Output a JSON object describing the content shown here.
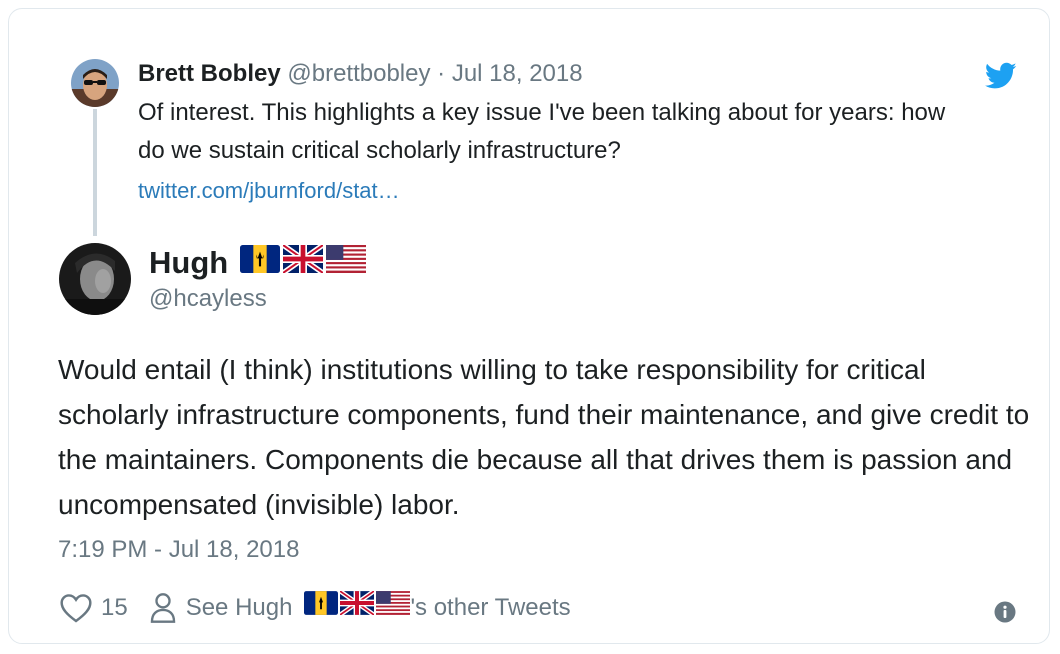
{
  "quoted": {
    "name": "Brett Bobley",
    "handle": "@brettbobley",
    "separator": "·",
    "date": "Jul 18, 2018",
    "text": "Of interest. This highlights a key issue I've been talking about for years: how do we sustain critical scholarly infrastructure?",
    "link": "twitter.com/jburnford/stat…"
  },
  "tweet": {
    "name": "Hugh",
    "handle": "@hcayless",
    "flags": [
      "barbados-flag-icon",
      "uk-flag-icon",
      "us-flag-icon"
    ],
    "text": "Would entail (I think) institutions willing to take responsibility for critical scholarly infrastructure components, fund their maintenance, and give credit to the maintainers. Components die because all that drives them is passion and uncompensated (invisible) labor.",
    "timestamp": "7:19 PM - Jul 18, 2018"
  },
  "actions": {
    "like_count": "15",
    "see_prefix": "See Hugh",
    "see_suffix": "'s other Tweets"
  },
  "icons": {
    "brand": "twitter-bird-icon",
    "like": "heart-icon",
    "profile": "person-icon",
    "info": "info-icon"
  },
  "colors": {
    "link": "#2b7bb9",
    "twitter_blue": "#1da1f2",
    "muted": "#697882",
    "text": "#1c2022",
    "border": "#e1e8ed"
  }
}
